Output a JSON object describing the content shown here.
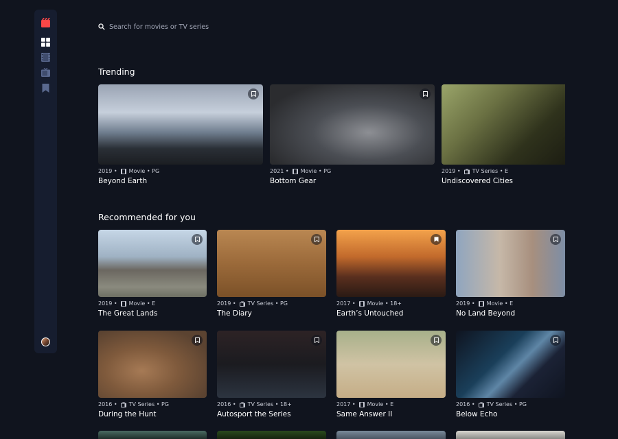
{
  "search": {
    "placeholder": "Search for movies or TV series"
  },
  "sidebar": {
    "items": [
      {
        "name": "home",
        "icon": "grid-icon",
        "active": true
      },
      {
        "name": "movies",
        "icon": "film-icon",
        "active": false
      },
      {
        "name": "tv-series",
        "icon": "tv-icon",
        "active": false
      },
      {
        "name": "bookmarks",
        "icon": "bookmark-icon",
        "active": false
      }
    ]
  },
  "colors": {
    "accent": "#fc4747",
    "nav_inactive": "#5a698f",
    "background": "#10141e",
    "sidebar": "#161d2f"
  },
  "trending": {
    "title": "Trending",
    "items": [
      {
        "year": "2019 •",
        "category": "Movie",
        "rating": "• PG",
        "name": "Beyond Earth",
        "icon": "film-icon"
      },
      {
        "year": "2021 •",
        "category": "Movie",
        "rating": "• PG",
        "name": "Bottom Gear",
        "icon": "film-icon"
      },
      {
        "year": "2019 •",
        "category": "TV Series",
        "rating": "• E",
        "name": "Undiscovered Cities",
        "icon": "tv-icon"
      }
    ]
  },
  "recommended": {
    "title": "Recommended for you",
    "items": [
      {
        "year": "2019 •",
        "category": "Movie",
        "rating": "• E",
        "name": "The Great Lands",
        "icon": "film-icon"
      },
      {
        "year": "2019 •",
        "category": "TV Series",
        "rating": "• PG",
        "name": "The Diary",
        "icon": "tv-icon"
      },
      {
        "year": "2017 •",
        "category": "Movie",
        "rating": "• 18+",
        "name": "Earth’s Untouched",
        "icon": "film-icon"
      },
      {
        "year": "2019 •",
        "category": "Movie",
        "rating": "• E",
        "name": "No Land Beyond",
        "icon": "film-icon"
      },
      {
        "year": "2016 •",
        "category": "TV Series",
        "rating": "• PG",
        "name": "During the Hunt",
        "icon": "tv-icon"
      },
      {
        "year": "2016 •",
        "category": "TV Series",
        "rating": "• 18+",
        "name": "Autosport the Series",
        "icon": "tv-icon"
      },
      {
        "year": "2017 •",
        "category": "Movie",
        "rating": "• E",
        "name": "Same Answer II",
        "icon": "film-icon"
      },
      {
        "year": "2016 •",
        "category": "TV Series",
        "rating": "• PG",
        "name": "Below Echo",
        "icon": "tv-icon"
      }
    ]
  }
}
